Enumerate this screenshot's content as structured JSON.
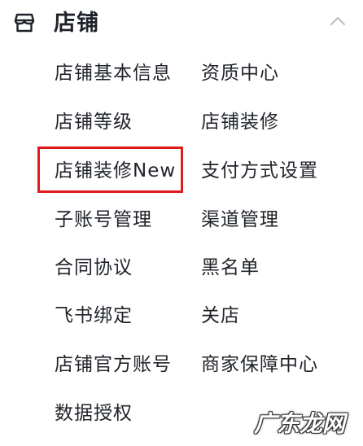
{
  "section": {
    "title": "店铺",
    "icon": "store-icon",
    "toggle_icon": "chevron-up-icon"
  },
  "menu": {
    "items": [
      {
        "label": "店铺基本信息"
      },
      {
        "label": "资质中心"
      },
      {
        "label": "店铺等级"
      },
      {
        "label": "店铺装修"
      },
      {
        "label": "店铺装修New"
      },
      {
        "label": "支付方式设置"
      },
      {
        "label": "子账号管理"
      },
      {
        "label": "渠道管理"
      },
      {
        "label": "合同协议"
      },
      {
        "label": "黑名单"
      },
      {
        "label": "飞书绑定"
      },
      {
        "label": "关店"
      },
      {
        "label": "店铺官方账号"
      },
      {
        "label": "商家保障中心"
      },
      {
        "label": "数据授权"
      }
    ]
  },
  "highlight": {
    "color": "#e01b1b",
    "target": "店铺装修New"
  },
  "watermark": {
    "text": "广东龙网"
  }
}
